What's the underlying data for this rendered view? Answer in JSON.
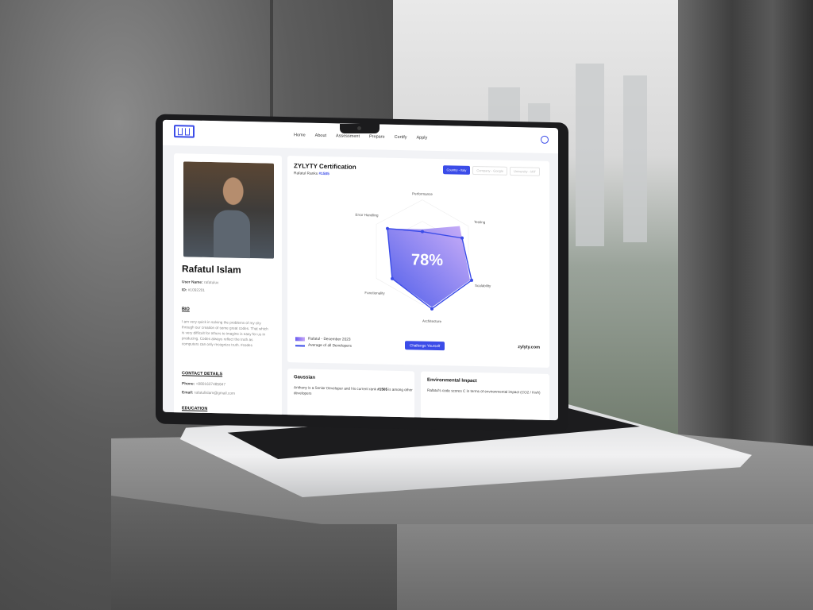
{
  "nav": {
    "items": [
      "Home",
      "About",
      "Assessment",
      "Prepare",
      "Certify",
      "Apply"
    ]
  },
  "profile": {
    "name": "Rafatul Islam",
    "username_label": "User Name:",
    "username_value": "rafatulux",
    "id_label": "ID:",
    "id_value": "#1092201",
    "bio_title": "BIO",
    "bio_text": "I am very quick in solving the problems of my city through our creation of some great codes. That which is very difficult for others to imagine is easy for us in producing. Codes always reflect the truth as computers can only recognize truth. #codes",
    "contact_title": "CONTACT DETAILS",
    "phone_label": "Phone:",
    "phone_value": "+8801637485847",
    "email_label": "Email:",
    "email_value": "rafatulislam@gmail.com",
    "education_title": "EDUCATION"
  },
  "certification": {
    "title": "ZYLYTY Certification",
    "rank_prefix": "Rafatul Ranks",
    "rank_value": "#1505",
    "tabs": [
      "Country - Italy",
      "Company - Google",
      "University - MIT"
    ],
    "score": "78%",
    "axes": [
      "Performance",
      "Testing",
      "Scalability",
      "Architecture",
      "Functionality",
      "Error Handling"
    ],
    "legend": [
      "Rafatul - December 2023",
      "Average of all Developers"
    ],
    "challenge_label": "Challenge Yourself",
    "brand": "zylyty.com"
  },
  "gaussian": {
    "title": "Gaussian",
    "text_prefix": "Anthony is a Senior Developer and his current rank",
    "rank": "#1505",
    "text_suffix": "is among other developers"
  },
  "environment": {
    "title": "Environmental Impact",
    "text": "Rafatul's code scores C in terms of environmental impact (CO2 / Kwh)"
  },
  "colors": {
    "accent": "#3b4ce8",
    "gradient_start": "#6a5cf0",
    "gradient_end": "#c6a6f7"
  }
}
